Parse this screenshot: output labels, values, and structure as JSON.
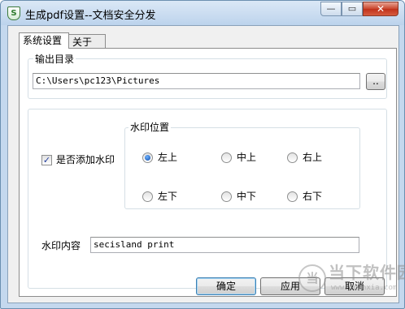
{
  "window": {
    "title": "生成pdf设置--文档安全分发",
    "controls": {
      "minimize": "—",
      "maximize": "▭",
      "close": "✕"
    }
  },
  "tabs": [
    {
      "label": "系统设置",
      "active": true
    },
    {
      "label": "关于",
      "active": false
    }
  ],
  "output_dir": {
    "group_label": "输出目录",
    "path_value": "C:\\Users\\pc123\\Pictures",
    "browse_label": ".."
  },
  "watermark": {
    "enable_label": "是否添加水印",
    "enabled": true,
    "position_group_label": "水印位置",
    "positions": [
      {
        "label": "左上",
        "checked": true
      },
      {
        "label": "中上",
        "checked": false
      },
      {
        "label": "右上",
        "checked": false
      },
      {
        "label": "左下",
        "checked": false
      },
      {
        "label": "中下",
        "checked": false
      },
      {
        "label": "右下",
        "checked": false
      }
    ],
    "content_label": "水印内容",
    "content_value": "secisland print"
  },
  "buttons": {
    "ok": "确定",
    "apply": "应用",
    "cancel": "取消"
  },
  "site_watermark": {
    "mark": "当",
    "text": "当下软件园",
    "sub": "www.downxia.com"
  }
}
